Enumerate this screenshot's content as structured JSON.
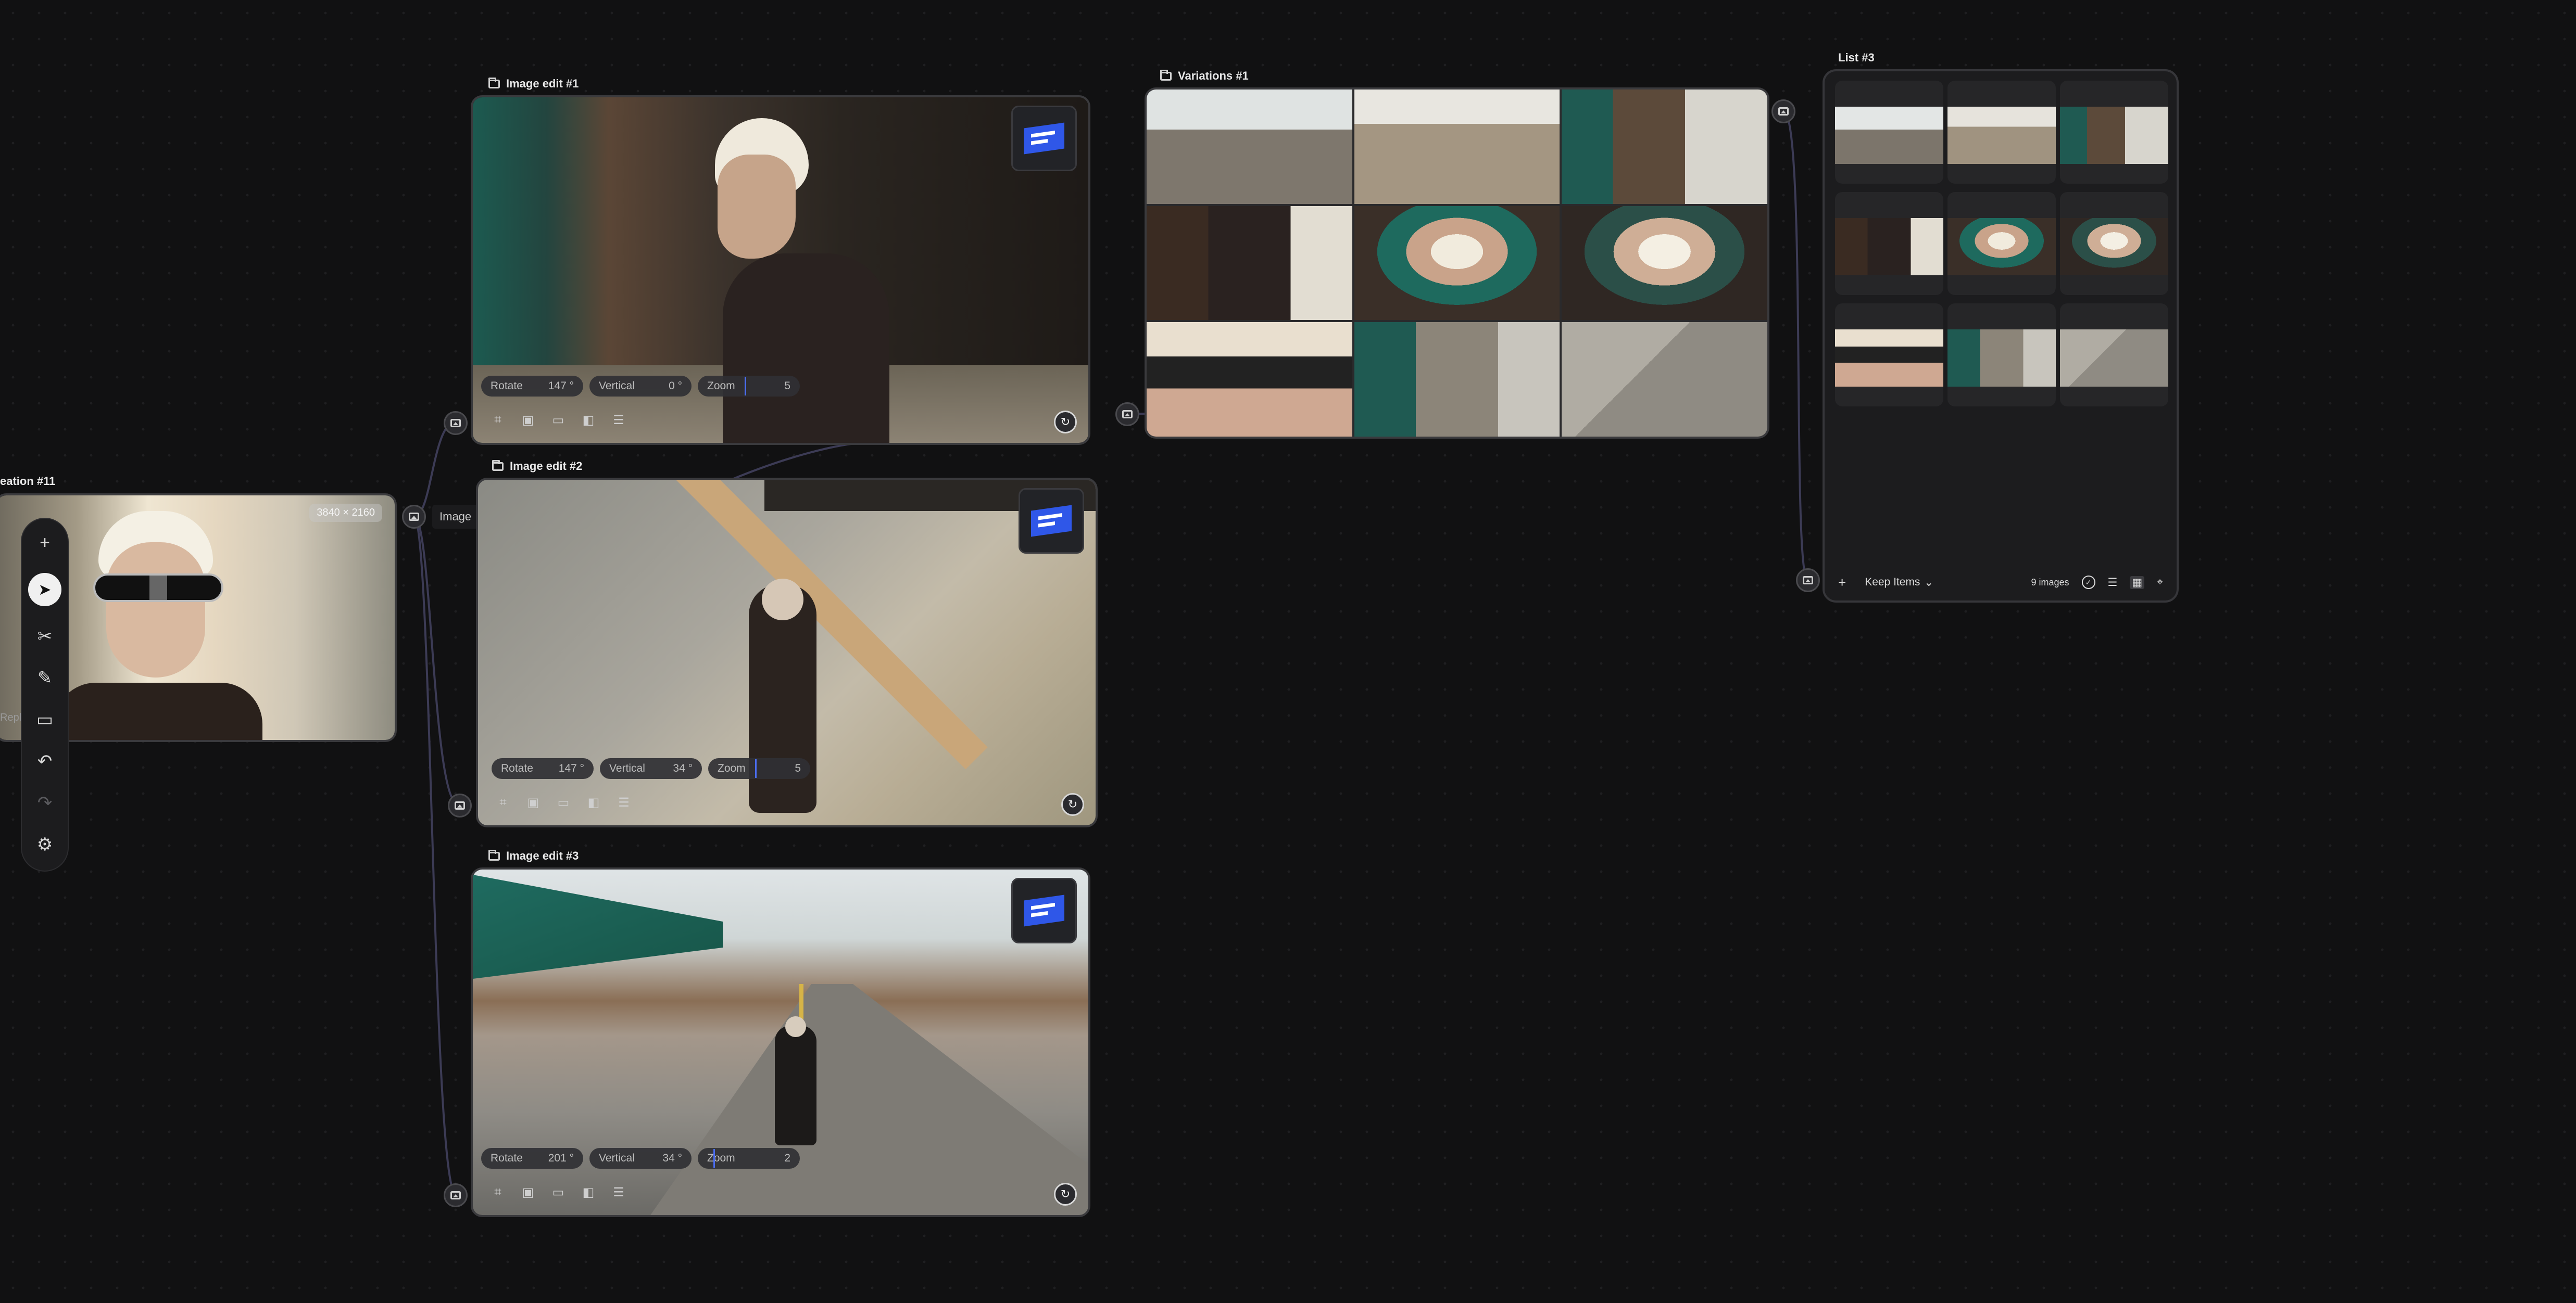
{
  "nodes": {
    "creation": {
      "title": "eation #11",
      "dimensions": "3840 × 2160",
      "side_label": "Repl"
    },
    "image_edit_1": {
      "title": "Image edit #1",
      "rotate_label": "Rotate",
      "rotate_value": "147 °",
      "vertical_label": "Vertical",
      "vertical_value": "0 °",
      "zoom_label": "Zoom",
      "zoom_value": "5"
    },
    "image_edit_2": {
      "title": "Image edit #2",
      "rotate_label": "Rotate",
      "rotate_value": "147 °",
      "vertical_label": "Vertical",
      "vertical_value": "34 °",
      "zoom_label": "Zoom",
      "zoom_value": "5"
    },
    "image_edit_3": {
      "title": "Image edit #3",
      "rotate_label": "Rotate",
      "rotate_value": "201 °",
      "vertical_label": "Vertical",
      "vertical_value": "34 °",
      "zoom_label": "Zoom",
      "zoom_value": "2"
    },
    "variations": {
      "title": "Variations #1"
    },
    "list": {
      "title": "List #3",
      "add_label": "+",
      "mode_label": "Keep Items",
      "count_label": "9 images"
    }
  },
  "connector_label": "Image",
  "toolbar": {
    "items": [
      "plus-icon",
      "select-pointer-icon",
      "scissors-icon",
      "pen-icon",
      "comment-icon",
      "undo-icon",
      "redo-icon",
      "settings-icon"
    ]
  },
  "edit_tools": [
    "crop-icon",
    "image-adjust-icon",
    "folder-icon",
    "compare-icon",
    "sliders-icon"
  ],
  "colors": {
    "background": "#111112",
    "accent": "#2f57e8",
    "card_border": "#3a3a3d"
  }
}
